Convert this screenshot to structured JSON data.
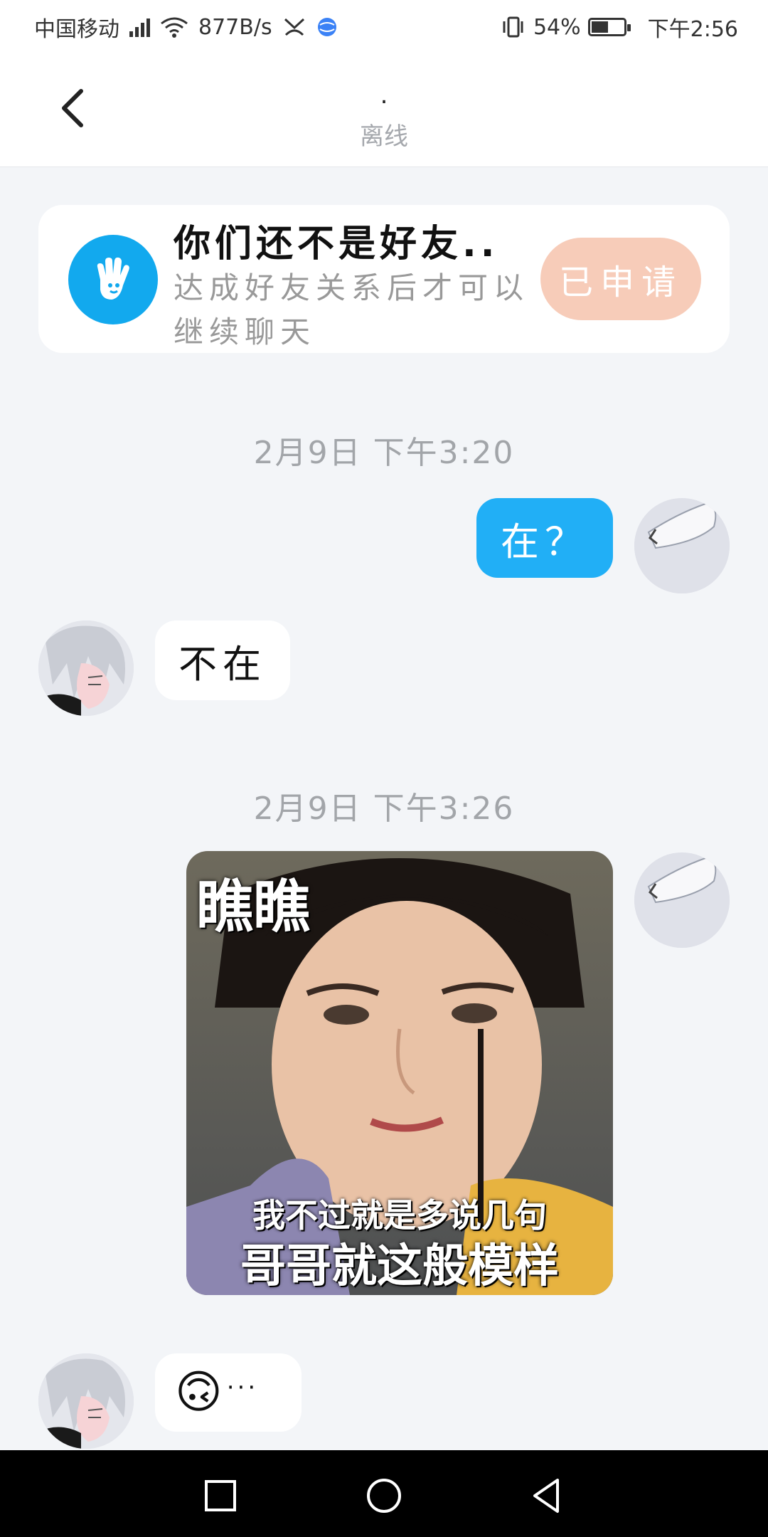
{
  "status_bar": {
    "carrier": "中国移动",
    "net_speed": "877B/s",
    "battery": "54%",
    "battery_level": 0.54,
    "time": "下午2:56"
  },
  "header": {
    "title": ".",
    "subtitle": "离线",
    "back_icon": "chevron-left-icon"
  },
  "friend_card": {
    "icon": "wave-hand-icon",
    "title": "你们还不是好友..",
    "description": "达成好友关系后才可以继续聊天",
    "button_label": "已申请",
    "button_color": "#f7ccb9"
  },
  "messages": {
    "ts1": "2月9日 下午3:20",
    "msg1": "在？",
    "msg2": "不在",
    "ts2": "2月9日 下午3:26",
    "sticker_top": "瞧瞧",
    "sticker_line1": "我不过就是多说几句",
    "sticker_line2": "哥哥就这般模样",
    "msg4_emoji": "🙃",
    "msg4_text": "···"
  },
  "colors": {
    "accent": "#21aff6",
    "background": "#f3f5f8"
  },
  "nav_bar": {
    "icons": [
      "square-recent-icon",
      "circle-home-icon",
      "triangle-back-icon"
    ]
  }
}
